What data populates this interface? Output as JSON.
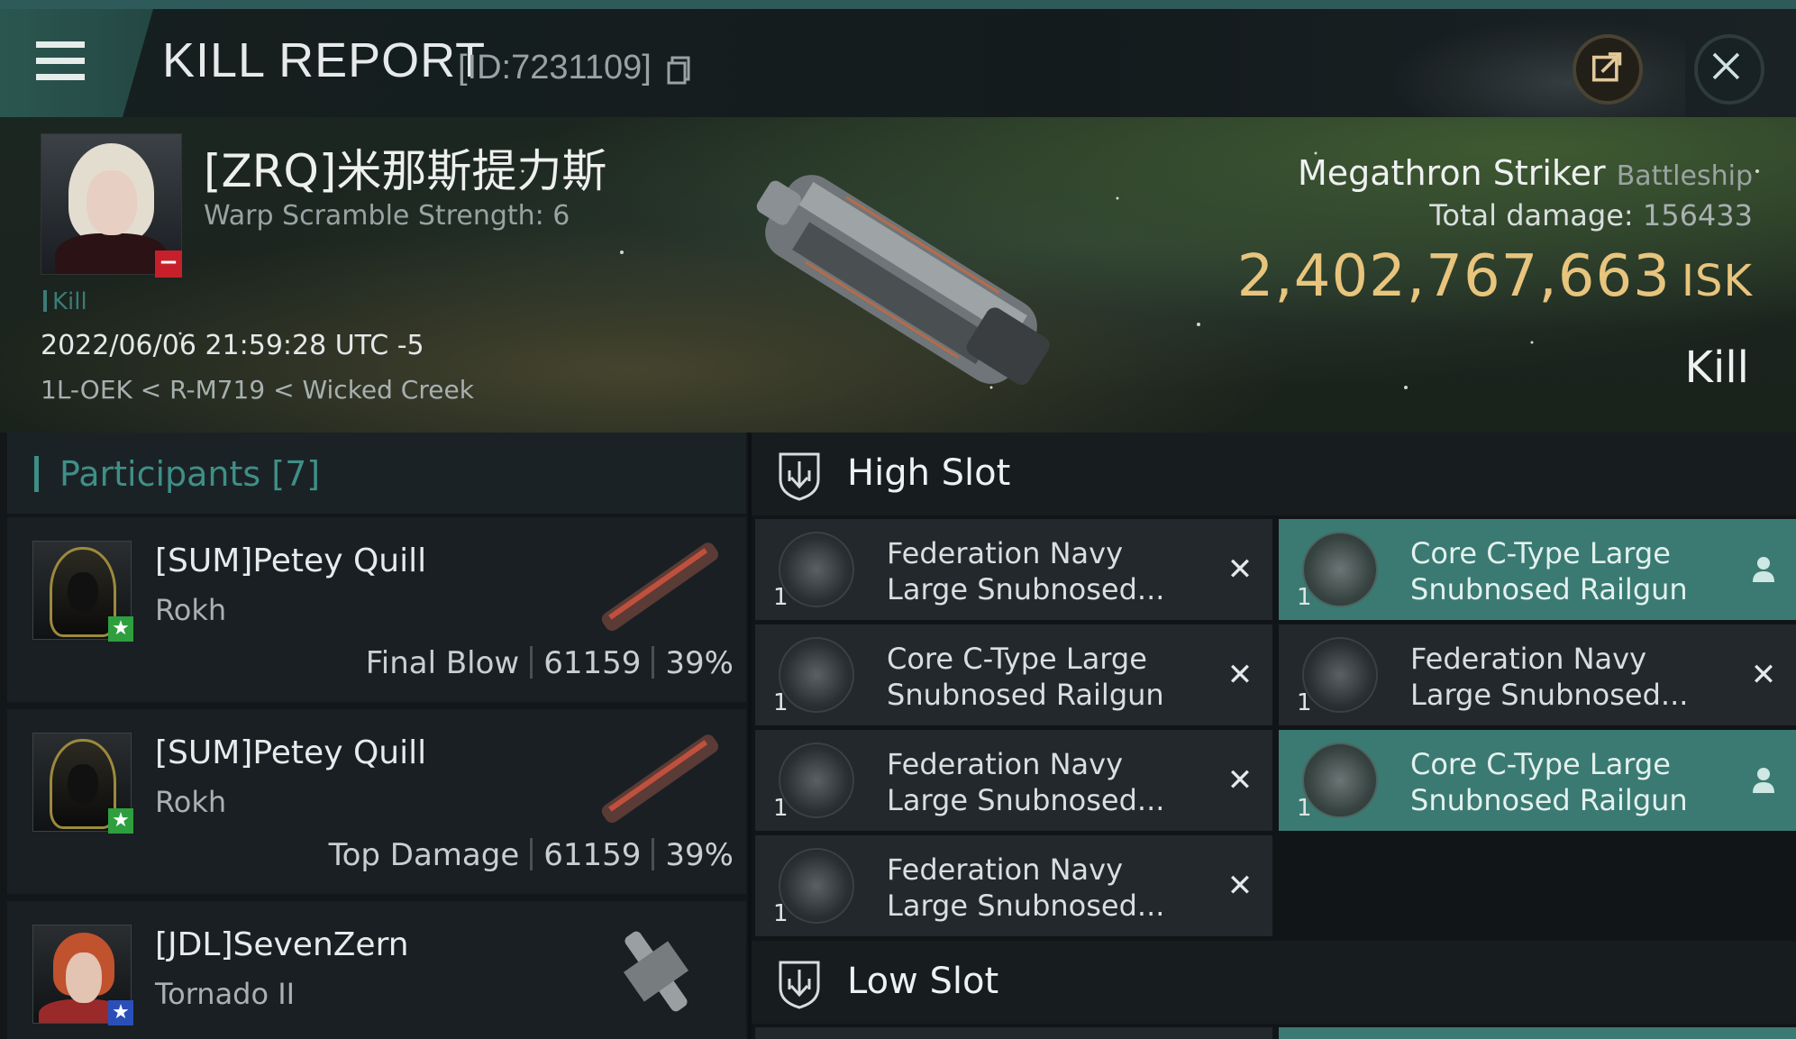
{
  "header": {
    "title": "KILL REPORT",
    "report_id": "[ID:7231109]"
  },
  "icons": {
    "menu": "menu-icon",
    "copy": "copy-icon",
    "share": "share-icon",
    "close": "close-icon"
  },
  "victim": {
    "name": "[ZRQ]米那斯提力斯",
    "warp_scramble": "Warp Scramble Strength: 6",
    "tag": "Kill",
    "datetime": "2022/06/06 21:59:28 UTC -5",
    "location": "1L-OEK < R-M719 < Wicked Creek",
    "ship": "Megathron Striker",
    "ship_class": "Battleship",
    "total_damage_label": "Total damage:",
    "total_damage_value": "156433",
    "isk_value": "2,402,767,663",
    "isk_unit": "ISK",
    "kill_type": "Kill"
  },
  "participants": {
    "label": "Participants [7]",
    "rows": [
      {
        "name": "[SUM]Petey Quill",
        "ship": "Rokh",
        "role": "Final Blow",
        "damage": "61159",
        "percent": "39%"
      },
      {
        "name": "[SUM]Petey Quill",
        "ship": "Rokh",
        "role": "Top Damage",
        "damage": "61159",
        "percent": "39%"
      },
      {
        "name": "[JDL]SevenZern",
        "ship": "Tornado II",
        "role": "",
        "damage": "",
        "percent": ""
      }
    ]
  },
  "slots": {
    "high_label": "High Slot",
    "low_label": "Low Slot",
    "high_modules": [
      {
        "qty": "1",
        "name": "Federation Navy Large Snubnosed...",
        "status": "destroyed"
      },
      {
        "qty": "1",
        "name": "Core C-Type Large Snubnosed Railgun",
        "status": "dropped"
      },
      {
        "qty": "1",
        "name": "Core C-Type Large Snubnosed Railgun",
        "status": "destroyed"
      },
      {
        "qty": "1",
        "name": "Federation Navy Large Snubnosed...",
        "status": "destroyed"
      },
      {
        "qty": "1",
        "name": "Federation Navy Large Snubnosed...",
        "status": "destroyed"
      },
      {
        "qty": "1",
        "name": "Core C-Type Large Snubnosed Railgun",
        "status": "dropped"
      },
      {
        "qty": "1",
        "name": "Federation Navy Large Snubnosed...",
        "status": "destroyed"
      }
    ]
  },
  "colors": {
    "accent_teal": "#3e8e86",
    "dropped_bg": "#3a7a72",
    "isk_gold": "#e8c47d",
    "destroyed_badge": "#c7202c",
    "ally_green": "#2e9f3e",
    "ally_blue": "#2a4fb8"
  }
}
